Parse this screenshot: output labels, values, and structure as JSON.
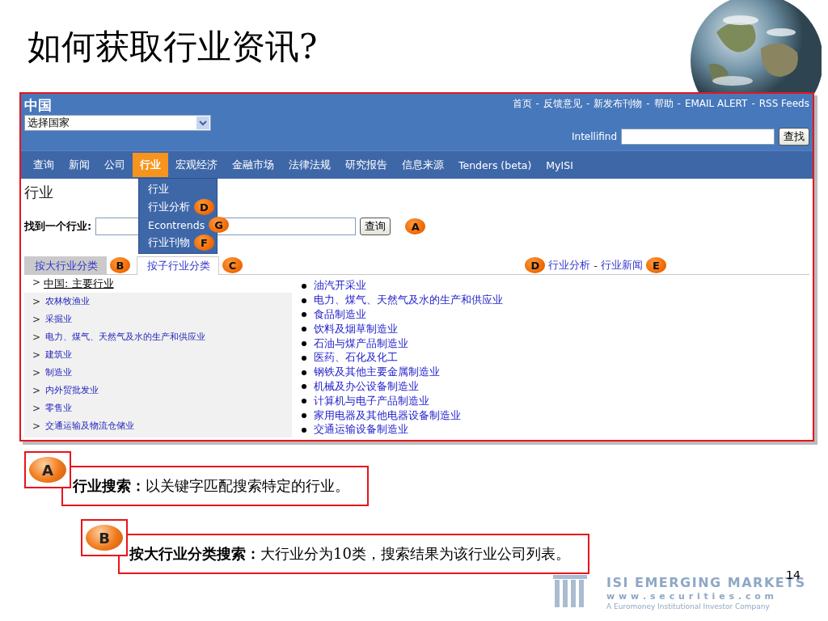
{
  "slide": {
    "title": "如何获取行业资讯?",
    "page_number": "14"
  },
  "logo": {
    "name": "ISI EMERGING MARKETS",
    "url": "w w w . s e c u r i t i e s . c o m",
    "tagline": "A Euromoney Institutional Investor Company"
  },
  "site": {
    "country": "中国",
    "country_select": {
      "value": "选择国家"
    },
    "top_links": [
      "首页",
      "反馈意见",
      "新发布刊物",
      "帮助",
      "EMAIL ALERT",
      "RSS Feeds"
    ],
    "link_separator": "-",
    "search": {
      "label": "Intellifind",
      "button": "查找"
    },
    "nav": [
      {
        "label": "查询",
        "selected": false
      },
      {
        "label": "新闻",
        "selected": false
      },
      {
        "label": "公司",
        "selected": false
      },
      {
        "label": "行业",
        "selected": true
      },
      {
        "label": "宏观经济",
        "selected": false
      },
      {
        "label": "金融市场",
        "selected": false
      },
      {
        "label": "法律法规",
        "selected": false
      },
      {
        "label": "研究报告",
        "selected": false
      },
      {
        "label": "信息来源",
        "selected": false
      },
      {
        "label": "Tenders (beta)",
        "selected": false
      },
      {
        "label": "MyISI",
        "selected": false
      }
    ],
    "menu": [
      {
        "label": "行业"
      },
      {
        "label": "行业分析",
        "marker": "D"
      },
      {
        "label": "Econtrends",
        "marker": "G"
      },
      {
        "label": "行业刊物",
        "marker": "F"
      }
    ],
    "page_title": "行业",
    "find": {
      "label": "找到一个行业",
      "colon": ":",
      "button": "查询",
      "marker": "A"
    },
    "tabs": [
      {
        "label": "按大行业分类",
        "selected": true,
        "marker": "B"
      },
      {
        "label": "按子行业分类",
        "selected": false,
        "marker": "C"
      }
    ],
    "side_links": {
      "marker_before": "D",
      "items": [
        "行业分析",
        "行业新闻"
      ],
      "separator": "-",
      "marker_after": "E"
    },
    "categories": {
      "chevron": ">",
      "heading": "中国: 主要行业",
      "items": [
        "农林牧渔业",
        "采掘业",
        "电力、煤气、天然气及水的生产和供应业",
        "建筑业",
        "制造业",
        "内外贸批发业",
        "零售业",
        "交通运输及物流仓储业"
      ]
    },
    "subindustries": [
      "油汽开采业",
      "电力、煤气、天然气及水的生产和供应业",
      "食品制造业",
      "饮料及烟草制造业",
      "石油与煤产品制造业",
      "医药、石化及化工",
      "钢铁及其他主要金属制造业",
      "机械及办公设备制造业",
      "计算机与电子产品制造业",
      "家用电器及其他电器设备制造业",
      "交通运输设备制造业"
    ]
  },
  "callouts": [
    {
      "marker": "A",
      "text": "**行业搜索：**以关键字匹配搜索特定的行业。"
    },
    {
      "marker": "B",
      "text": "**按大行业分类搜索：**大行业分为10类，搜索结果为该行业公司列表。"
    }
  ]
}
